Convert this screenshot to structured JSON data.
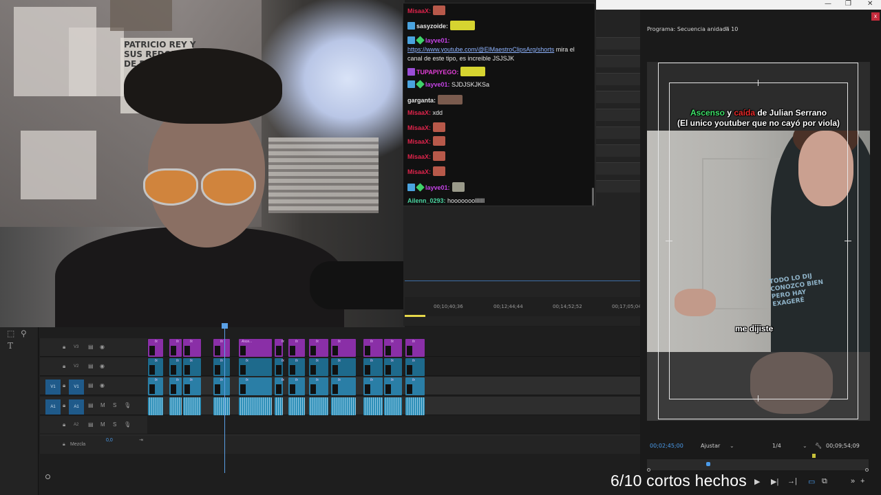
{
  "window": {
    "minimize": "—",
    "restore": "❐",
    "close": "✕"
  },
  "chat": {
    "messages": [
      {
        "user": "MisaaX:",
        "user_color": "#e0244c",
        "text": "",
        "emote": true,
        "badges": []
      },
      {
        "user": "sasyzoide:",
        "user_color": "#e6e6e6",
        "text": "",
        "emote": true,
        "badges": [
          "blue"
        ]
      },
      {
        "user": "layve01:",
        "user_color": "#c643e8",
        "text": "",
        "link": "https://www.youtube.com/@ElMaestroClipsArg/shorts",
        "text2": " mira el canal de este tipo, es increible JSJSJK",
        "badges": [
          "blue",
          "green"
        ]
      },
      {
        "user": "TUPAPIYEGO:",
        "user_color": "#e33fd8",
        "text": "",
        "emote": true,
        "badges": [
          "purple"
        ]
      },
      {
        "user": "layve01:",
        "user_color": "#c643e8",
        "text": " SJDJSKJKSa",
        "badges": [
          "blue",
          "green"
        ]
      },
      {
        "user": "garganta:",
        "user_color": "#e6e6e6",
        "text": "",
        "emote": true,
        "badges": []
      },
      {
        "user": "MisaaX:",
        "user_color": "#e0244c",
        "text": " xdd",
        "badges": []
      },
      {
        "user": "MisaaX:",
        "user_color": "#e0244c",
        "text": "",
        "emote": true,
        "badges": []
      },
      {
        "user": "MisaaX:",
        "user_color": "#e0244c",
        "text": "",
        "emote": true,
        "badges": []
      },
      {
        "user": "MisaaX:",
        "user_color": "#e0244c",
        "text": "",
        "emote": true,
        "badges": []
      },
      {
        "user": "MisaaX:",
        "user_color": "#e0244c",
        "text": "",
        "emote": true,
        "badges": []
      },
      {
        "user": "layve01:",
        "user_color": "#c643e8",
        "text": "",
        "emote": true,
        "badges": [
          "blue",
          "green"
        ]
      },
      {
        "user": "Ailenn_0293:",
        "user_color": "#4ad4a0",
        "text": " hooooooolllllll",
        "badges": []
      }
    ]
  },
  "ruler": {
    "t1": "00;10;40;36",
    "t2": "00;12;44;44",
    "t3": "00;14;52;52",
    "t4": "00;17;05;04"
  },
  "tracks": {
    "v3": "V3",
    "v2": "V2",
    "v1": "V1",
    "a1": "A1",
    "a2": "A2",
    "patch_v1": "V1",
    "patch_a1": "A1",
    "mute": "M",
    "solo": "S",
    "mix_label": "Mezcla",
    "mix_value": "0,0",
    "clip_label": "Asce...",
    "fx": "fx"
  },
  "tools": {
    "select_tool": "⬚",
    "zoom_tool": "⚲",
    "type_tool": "T"
  },
  "program": {
    "title": "Programa: Secuencia anidada 10",
    "menu": "≡",
    "close": "x",
    "headline_w1": "Ascenso",
    "headline_w2": " y ",
    "headline_w3": "caída",
    "headline_w4": " de Julian Serrano",
    "headline_line2": "(El unico youtuber que no cayó por viola)",
    "subtitle": "me dijiste",
    "shirt_text": "TODO LO DIJ\nCONOZCO BIEN\nPERO HAY\nEXAGERÉ",
    "timecode_current": "00;02;45;00",
    "fit": "Ajustar",
    "resolution": "1/4",
    "timecode_total": "00;09;54;09",
    "colors": {
      "green": "#3fe26a",
      "red": "#e82a2a",
      "timecode": "#4a9bea"
    }
  },
  "transport": {
    "play": "▶",
    "step_fwd": "▶|",
    "next": "→|",
    "camera": "▭",
    "compare": "⧉",
    "more": "»",
    "add": "+"
  },
  "overlay": {
    "progress_text": "6/10 cortos hechos"
  },
  "webcam": {
    "poster_text": "PATRICIO REY Y\nSUS REDONDOS\nDE RICOTA"
  }
}
